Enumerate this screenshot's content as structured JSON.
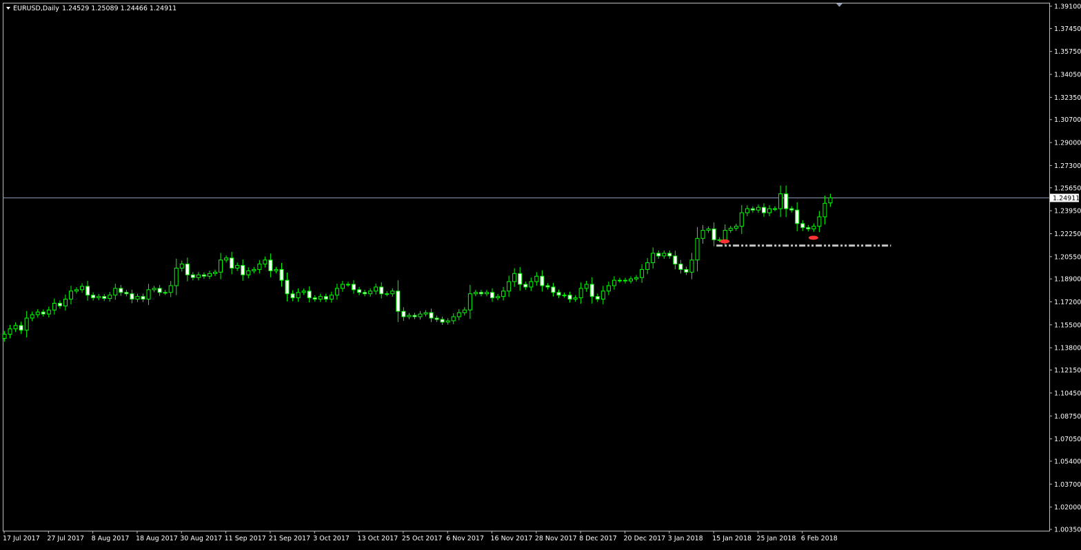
{
  "window": {
    "symbol_label": "EURUSD,Daily",
    "ohlc_label": "1.24529 1.25089 1.24466 1.24911"
  },
  "colors": {
    "background": "#000000",
    "frame": "#c0c0c0",
    "bull_candle": "#00ff00",
    "bear_candle_body": "#ffffff",
    "bid_line": "#8c9bb3",
    "marker": "#ff3333",
    "support_line": "#c8c8c8",
    "axis_text": "#ffffff"
  },
  "chart_data": {
    "type": "candlestick",
    "title": "EURUSD,Daily",
    "grid": false,
    "ylim": [
      1.0035,
      1.391
    ],
    "y_ticks": [
      1.391,
      1.3745,
      1.3575,
      1.3405,
      1.3235,
      1.307,
      1.29,
      1.273,
      1.2565,
      1.2395,
      1.2225,
      1.2055,
      1.189,
      1.172,
      1.155,
      1.138,
      1.1215,
      1.1045,
      1.0875,
      1.0705,
      1.054,
      1.037,
      1.02,
      1.0035
    ],
    "y_tick_labels": [
      "1.39100",
      "1.37450",
      "1.35750",
      "1.34050",
      "1.32350",
      "1.30700",
      "1.29000",
      "1.27300",
      "1.25650",
      "1.23950",
      "1.22250",
      "1.20550",
      "1.18900",
      "1.17200",
      "1.15500",
      "1.13800",
      "1.12150",
      "1.10450",
      "1.08750",
      "1.07050",
      "1.05400",
      "1.03700",
      "1.02000",
      "1.00350"
    ],
    "x_tick_labels": [
      "17 Jul 2017",
      "27 Jul 2017",
      "8 Aug 2017",
      "18 Aug 2017",
      "30 Aug 2017",
      "11 Sep 2017",
      "21 Sep 2017",
      "3 Oct 2017",
      "13 Oct 2017",
      "25 Oct 2017",
      "6 Nov 2017",
      "16 Nov 2017",
      "28 Nov 2017",
      "8 Dec 2017",
      "20 Dec 2017",
      "3 Jan 2018",
      "15 Jan 2018",
      "25 Jan 2018",
      "6 Feb 2018"
    ],
    "x_tick_index": [
      0,
      8,
      16,
      24,
      32,
      40,
      48,
      56,
      64,
      72,
      80,
      88,
      96,
      104,
      112,
      120,
      128,
      136,
      144
    ],
    "current_price": 1.24911,
    "current_price_label": "1.24911",
    "support_level": 1.2137,
    "support_range_index": [
      128.5,
      160
    ],
    "markers": [
      {
        "index": 130,
        "price": 1.2168
      },
      {
        "index": 146,
        "price": 1.2195
      }
    ],
    "closes": [
      1.148,
      1.152,
      1.1545,
      1.151,
      1.16,
      1.1625,
      1.1645,
      1.163,
      1.166,
      1.171,
      1.169,
      1.174,
      1.18,
      1.181,
      1.1835,
      1.177,
      1.175,
      1.176,
      1.1745,
      1.177,
      1.182,
      1.179,
      1.178,
      1.174,
      1.176,
      1.174,
      1.181,
      1.182,
      1.179,
      1.179,
      1.184,
      1.197,
      1.2,
      1.192,
      1.19,
      1.192,
      1.191,
      1.193,
      1.194,
      1.203,
      1.2045,
      1.197,
      1.199,
      1.192,
      1.195,
      1.196,
      1.2,
      1.203,
      1.195,
      1.196,
      1.188,
      1.178,
      1.175,
      1.179,
      1.18,
      1.175,
      1.174,
      1.176,
      1.174,
      1.177,
      1.182,
      1.185,
      1.185,
      1.181,
      1.179,
      1.178,
      1.18,
      1.183,
      1.178,
      1.178,
      1.18,
      1.165,
      1.161,
      1.162,
      1.161,
      1.163,
      1.164,
      1.16,
      1.159,
      1.157,
      1.158,
      1.161,
      1.164,
      1.166,
      1.178,
      1.179,
      1.178,
      1.179,
      1.175,
      1.176,
      1.18,
      1.187,
      1.193,
      1.185,
      1.183,
      1.187,
      1.191,
      1.184,
      1.183,
      1.179,
      1.177,
      1.177,
      1.174,
      1.175,
      1.182,
      1.185,
      1.176,
      1.174,
      1.18,
      1.184,
      1.188,
      1.188,
      1.1875,
      1.189,
      1.19,
      1.196,
      1.201,
      1.208,
      1.206,
      1.208,
      1.206,
      1.2,
      1.196,
      1.194,
      1.203,
      1.219,
      1.225,
      1.226,
      1.218,
      1.218,
      1.225,
      1.2265,
      1.228,
      1.238,
      1.241,
      1.24,
      1.242,
      1.238,
      1.241,
      1.241,
      1.252,
      1.241,
      1.24,
      1.23,
      1.227,
      1.226,
      1.228,
      1.235,
      1.245,
      1.2491
    ],
    "opens": [
      1.145,
      1.148,
      1.152,
      1.1545,
      1.151,
      1.16,
      1.1625,
      1.1645,
      1.163,
      1.166,
      1.171,
      1.169,
      1.174,
      1.18,
      1.181,
      1.1835,
      1.177,
      1.175,
      1.176,
      1.1745,
      1.177,
      1.182,
      1.179,
      1.178,
      1.174,
      1.176,
      1.174,
      1.181,
      1.182,
      1.179,
      1.179,
      1.184,
      1.197,
      1.2,
      1.192,
      1.19,
      1.192,
      1.191,
      1.193,
      1.194,
      1.203,
      1.2045,
      1.197,
      1.199,
      1.192,
      1.195,
      1.196,
      1.2,
      1.203,
      1.195,
      1.196,
      1.188,
      1.178,
      1.175,
      1.179,
      1.18,
      1.175,
      1.174,
      1.176,
      1.174,
      1.177,
      1.182,
      1.185,
      1.185,
      1.181,
      1.179,
      1.178,
      1.18,
      1.183,
      1.178,
      1.178,
      1.18,
      1.165,
      1.161,
      1.162,
      1.161,
      1.163,
      1.164,
      1.16,
      1.159,
      1.157,
      1.158,
      1.161,
      1.164,
      1.166,
      1.178,
      1.179,
      1.178,
      1.179,
      1.175,
      1.176,
      1.18,
      1.187,
      1.193,
      1.185,
      1.183,
      1.187,
      1.191,
      1.184,
      1.183,
      1.179,
      1.177,
      1.177,
      1.174,
      1.175,
      1.182,
      1.185,
      1.176,
      1.174,
      1.18,
      1.184,
      1.188,
      1.188,
      1.1875,
      1.189,
      1.19,
      1.196,
      1.201,
      1.208,
      1.206,
      1.208,
      1.206,
      1.2,
      1.196,
      1.194,
      1.203,
      1.219,
      1.225,
      1.226,
      1.218,
      1.218,
      1.225,
      1.2265,
      1.228,
      1.238,
      1.241,
      1.24,
      1.242,
      1.238,
      1.241,
      1.241,
      1.252,
      1.241,
      1.24,
      1.23,
      1.227,
      1.226,
      1.228,
      1.235,
      1.2453
    ]
  }
}
